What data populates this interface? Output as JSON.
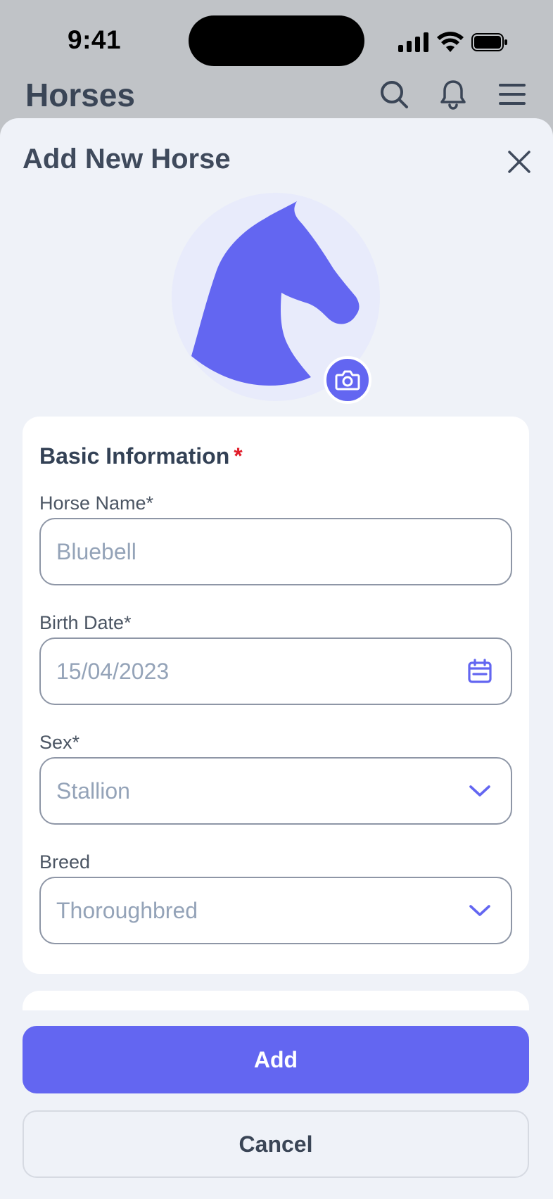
{
  "status_bar": {
    "time": "9:41",
    "icons": [
      "signal-icon",
      "wifi-icon",
      "battery-icon"
    ]
  },
  "header": {
    "title": "Horses",
    "icons": [
      "search-icon",
      "bell-icon",
      "menu-icon"
    ]
  },
  "sheet": {
    "title": "Add New Horse",
    "close_icon": "close-icon",
    "avatar_icon": "horse-head-icon",
    "camera_icon": "camera-icon"
  },
  "basic_info": {
    "title": "Basic Information",
    "required_mark": "*",
    "fields": [
      {
        "label": "Horse Name*",
        "value": "Bluebell"
      },
      {
        "label": "Birth Date*",
        "value": "15/04/2023",
        "icon": "calendar-icon"
      },
      {
        "label": "Sex*",
        "value": "Stallion",
        "icon": "chevron-down-icon"
      },
      {
        "label": "Breed",
        "value": "Thoroughbred",
        "icon": "chevron-down-icon"
      }
    ]
  },
  "actions": {
    "add_label": "Add",
    "cancel_label": "Cancel"
  },
  "colors": {
    "accent": "#6366f1",
    "sheet_bg": "#eff2f8",
    "backdrop": "#c0c3c7",
    "required": "#e11d2a"
  }
}
